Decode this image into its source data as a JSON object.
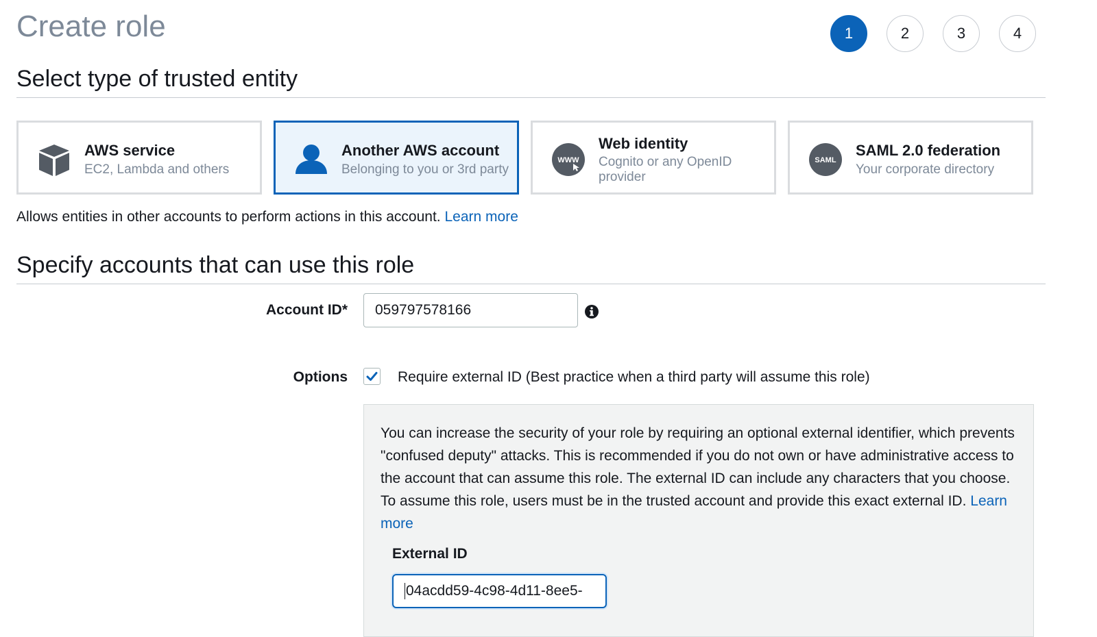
{
  "header": {
    "title": "Create role",
    "steps": [
      "1",
      "2",
      "3",
      "4"
    ]
  },
  "section1": {
    "title": "Select type of trusted entity"
  },
  "cards": [
    {
      "title": "AWS service",
      "subtitle": "EC2, Lambda and others",
      "icon": "cube-icon"
    },
    {
      "title": "Another AWS account",
      "subtitle": "Belonging to you or 3rd party",
      "icon": "user-icon"
    },
    {
      "title": "Web identity",
      "subtitle": "Cognito or any OpenID provider",
      "icon": "www-icon",
      "icon_text": "WWW"
    },
    {
      "title": "SAML 2.0 federation",
      "subtitle": "Your corporate directory",
      "icon": "saml-icon",
      "icon_text": "SAML"
    }
  ],
  "description": {
    "text": "Allows entities in other accounts to perform actions in this account.",
    "link": "Learn more"
  },
  "section2": {
    "title": "Specify accounts that can use this role"
  },
  "account": {
    "label": "Account ID*",
    "value": "059797578166"
  },
  "options": {
    "label": "Options",
    "checkbox_label": "Require external ID (Best practice when a third party will assume this role)",
    "checked": true
  },
  "external": {
    "help_text": "You can increase the security of your role by requiring an optional external identifier, which prevents \"confused deputy\" attacks. This is recommended if you do not own or have administrative access to the account that can assume this role. The external ID can include any characters that you choose. To assume this role, users must be in the trusted account and provide this exact external ID.",
    "help_link": "Learn more",
    "label": "External ID",
    "value": "04acdd59-4c98-4d11-8ee5-"
  },
  "colors": {
    "accent": "#0b63b8",
    "selected_bg": "#ebf4fc",
    "muted": "#7d8998",
    "icon_gray": "#545b64"
  }
}
